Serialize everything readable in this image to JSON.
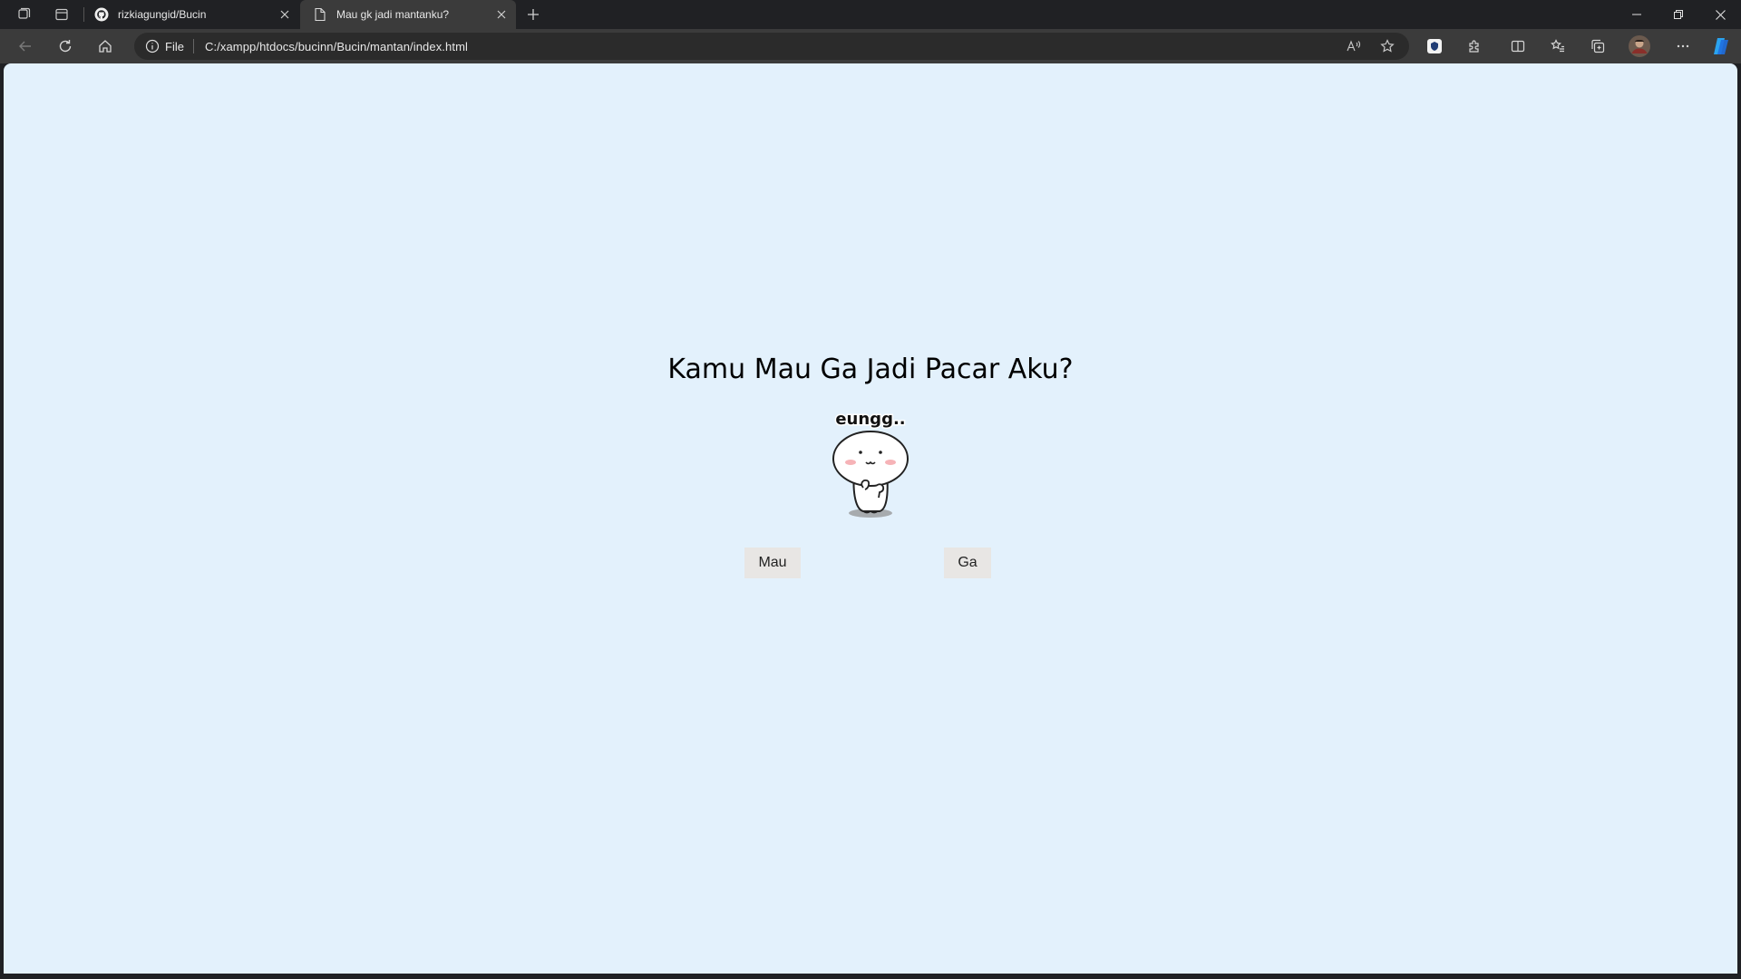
{
  "browser": {
    "tabs": [
      {
        "title": "rizkiagungid/Bucin",
        "favicon": "github-icon",
        "active": false
      },
      {
        "title": "Mau gk jadi mantanku?",
        "favicon": "page-icon",
        "active": true
      }
    ],
    "address_bar": {
      "scheme_label": "File",
      "url": "C:/xampp/htdocs/bucinn/Bucin/mantan/index.html"
    }
  },
  "page": {
    "question": "Kamu Mau Ga Jadi Pacar Aku?",
    "mascot_caption": "eungg..",
    "yes_button": "Mau",
    "no_button": "Ga",
    "background_color": "#e3f1fc"
  }
}
